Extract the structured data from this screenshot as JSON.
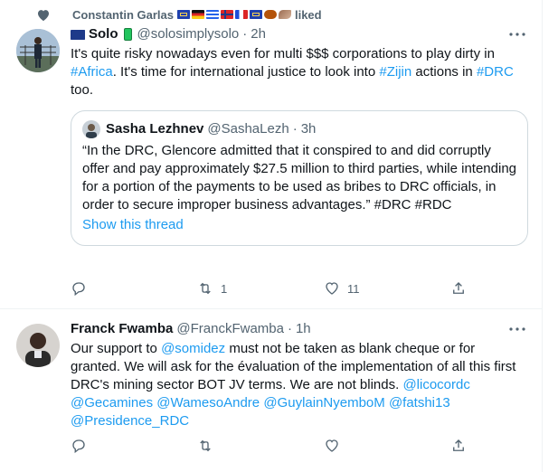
{
  "social_context": {
    "user": "Constantin Garlas",
    "suffix": "liked"
  },
  "tweets": [
    {
      "display_name": "Solo",
      "handle": "@solosimplysolo",
      "separator": "·",
      "time": "2h",
      "text_parts": [
        {
          "t": "It's quite risky nowadays even for multi $$$ corporations to play dirty in ",
          "link": false
        },
        {
          "t": "#Africa",
          "link": true
        },
        {
          "t": ". It's time for international justice to look into ",
          "link": false
        },
        {
          "t": "#Zijin",
          "link": true
        },
        {
          "t": " actions in ",
          "link": false
        },
        {
          "t": "#DRC",
          "link": true
        },
        {
          "t": " too.",
          "link": false
        }
      ],
      "quote": {
        "display_name": "Sasha Lezhnev",
        "handle": "@SashaLezh",
        "separator": "·",
        "time": "3h",
        "text": "“In the DRC, Glencore admitted that it conspired to and did corruptly offer and pay approximately $27.5 million to third parties, while intending for a portion of the payments to be used as bribes to DRC officials, in order to secure improper business advantages.” #DRC #RDC",
        "show_thread": "Show this thread"
      },
      "counts": {
        "reply": "",
        "retweet": "1",
        "like": "11"
      }
    },
    {
      "display_name": "Franck Fwamba",
      "handle": "@FranckFwamba",
      "separator": "·",
      "time": "1h",
      "text_parts": [
        {
          "t": "Our support to ",
          "link": false
        },
        {
          "t": "@somidez",
          "link": true
        },
        {
          "t": " must not be taken as blank cheque or for granted. We will ask for the évaluation of the implementation of all this first DRC's mining sector BOT JV terms. We are not blinds. ",
          "link": false
        },
        {
          "t": "@licocordc",
          "link": true
        },
        {
          "t": " ",
          "link": false
        },
        {
          "t": "@Gecamines",
          "link": true
        },
        {
          "t": " ",
          "link": false
        },
        {
          "t": "@WamesoAndre",
          "link": true
        },
        {
          "t": " ",
          "link": false
        },
        {
          "t": "@GuylainNyemboM",
          "link": true
        },
        {
          "t": " ",
          "link": false
        },
        {
          "t": "@fatshi13",
          "link": true
        },
        {
          "t": " ",
          "link": false
        },
        {
          "t": "@Presidence_RDC",
          "link": true
        }
      ],
      "counts": {
        "reply": "",
        "retweet": "",
        "like": ""
      }
    }
  ],
  "icons": {
    "social": "heart-icon",
    "flags": [
      "flag-eu-icon",
      "flag-germany-icon",
      "flag-greece-icon",
      "flag-norway-icon",
      "flag-france-icon",
      "flag-eu-icon",
      "hand-icon",
      "feather-icon"
    ],
    "solo_badge": [
      "flag-australia-icon",
      "battery-icon"
    ],
    "actions": [
      "reply-icon",
      "retweet-icon",
      "like-icon",
      "share-icon"
    ],
    "more": "more-icon"
  },
  "colors": {
    "link": "#1d9bf0",
    "muted": "#536471",
    "text": "#0f1419",
    "border": "#cfd9de"
  }
}
